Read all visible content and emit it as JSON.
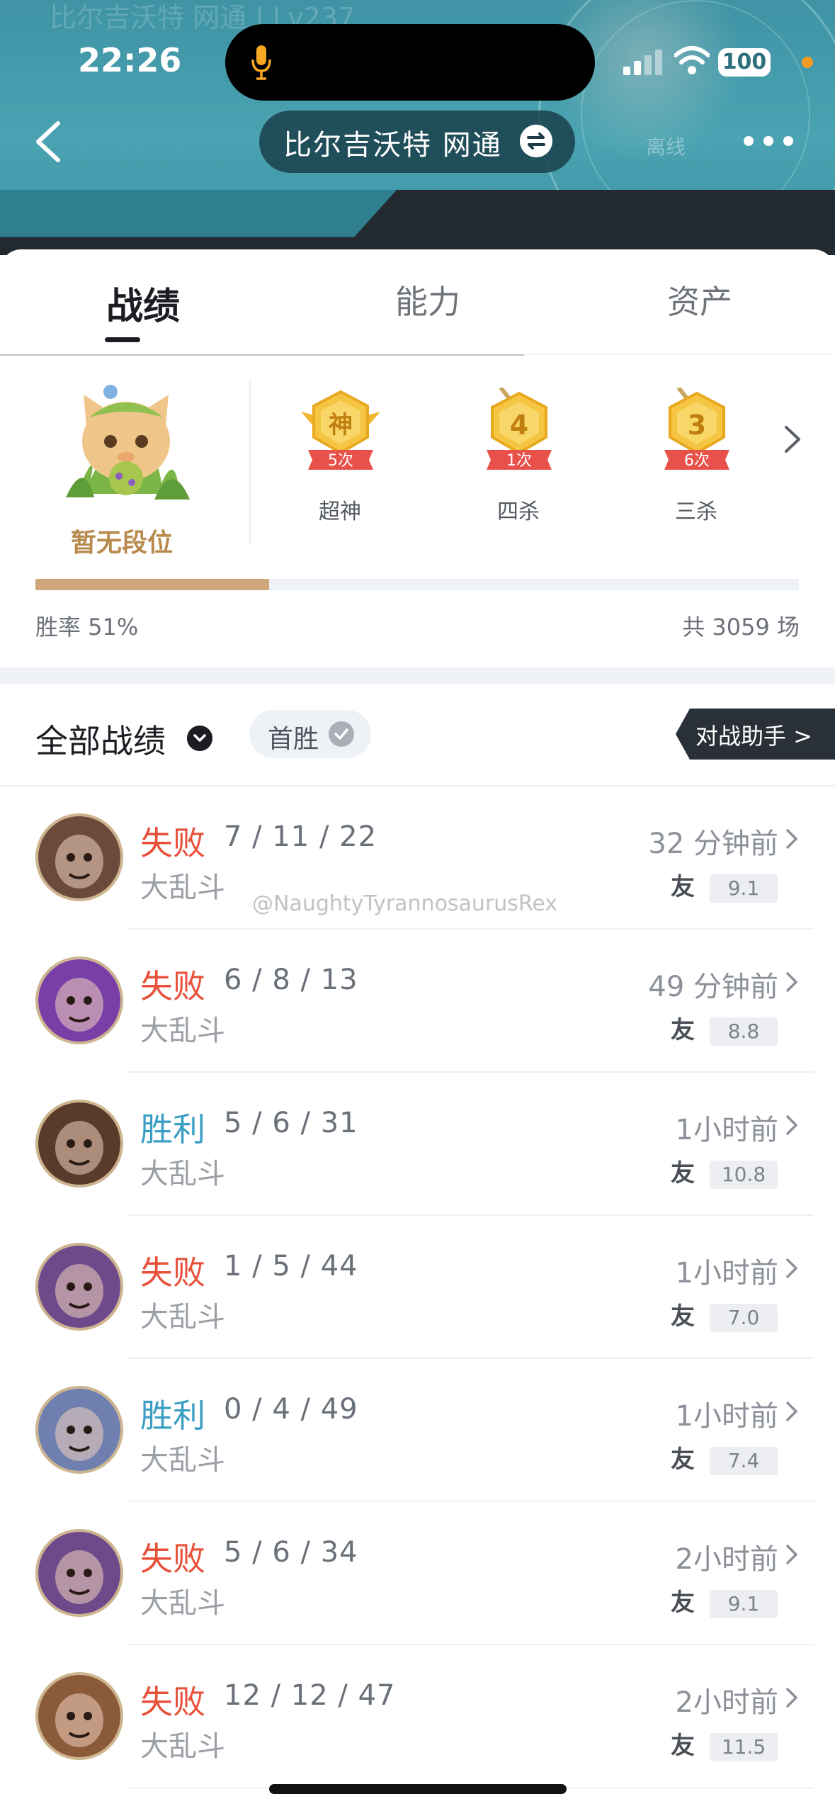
{
  "status_bar": {
    "time": "22:26",
    "battery": "100"
  },
  "header": {
    "ghost_text": "比尔吉沃特 网通 | Lv237",
    "server_name": "比尔吉沃特  网通",
    "offline_label": "离线"
  },
  "tabs": [
    {
      "label": "战绩",
      "active": true
    },
    {
      "label": "能力",
      "active": false
    },
    {
      "label": "资产",
      "active": false
    }
  ],
  "rank": {
    "label": "暂无段位"
  },
  "achievements": [
    {
      "badge": "神",
      "count": "5次",
      "name": "超神"
    },
    {
      "badge": "4",
      "count": "1次",
      "name": "四杀"
    },
    {
      "badge": "3",
      "count": "6次",
      "name": "三杀"
    }
  ],
  "stats": {
    "win_rate_label": "胜率 51%",
    "win_rate": 0.51,
    "total_label": "共 3059 场"
  },
  "filter": {
    "title": "全部战绩",
    "first_win_label": "首胜",
    "assistant_label": "对战助手 >"
  },
  "watermark": "@NaughtyTyrannosaurusRex",
  "matches": [
    {
      "result": "失败",
      "kda": "7 / 11 / 22",
      "mode": "大乱斗",
      "time": "32 分钟前",
      "friend": "友",
      "score": "9.1",
      "win": false,
      "avatar_color": "#6b4a3c"
    },
    {
      "result": "失败",
      "kda": "6 / 8 / 13",
      "mode": "大乱斗",
      "time": "49 分钟前",
      "friend": "友",
      "score": "8.8",
      "win": false,
      "avatar_color": "#7a3fa6"
    },
    {
      "result": "胜利",
      "kda": "5 / 6 / 31",
      "mode": "大乱斗",
      "time": "1小时前",
      "friend": "友",
      "score": "10.8",
      "win": true,
      "avatar_color": "#5a3a2a"
    },
    {
      "result": "失败",
      "kda": "1 / 5 / 44",
      "mode": "大乱斗",
      "time": "1小时前",
      "friend": "友",
      "score": "7.0",
      "win": false,
      "avatar_color": "#6e4a8a"
    },
    {
      "result": "胜利",
      "kda": "0 / 4 / 49",
      "mode": "大乱斗",
      "time": "1小时前",
      "friend": "友",
      "score": "7.4",
      "win": true,
      "avatar_color": "#6f7fb0"
    },
    {
      "result": "失败",
      "kda": "5 / 6 / 34",
      "mode": "大乱斗",
      "time": "2小时前",
      "friend": "友",
      "score": "9.1",
      "win": false,
      "avatar_color": "#6e4a8a"
    },
    {
      "result": "失败",
      "kda": "12 / 12 / 47",
      "mode": "大乱斗",
      "time": "2小时前",
      "friend": "友",
      "score": "11.5",
      "win": false,
      "avatar_color": "#8a5a3a"
    }
  ]
}
